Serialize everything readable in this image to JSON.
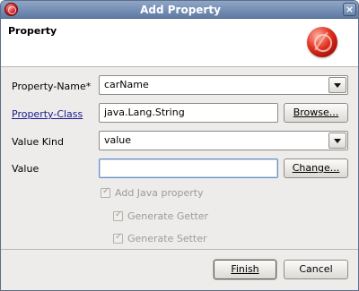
{
  "window": {
    "title": "Add Property"
  },
  "header": {
    "title": "Property"
  },
  "form": {
    "property_name": {
      "label": "Property-Name*",
      "value": "carName"
    },
    "property_class": {
      "label": "Property-Class",
      "value": "java.Lang.String",
      "browse_label": "Browse..."
    },
    "value_kind": {
      "label": "Value Kind",
      "value": "value"
    },
    "value": {
      "label": "Value",
      "value": "",
      "change_label": "Change..."
    },
    "add_java_property": {
      "label": "Add Java property",
      "checked": true,
      "enabled": false
    },
    "generate_getter": {
      "label": "Generate Getter",
      "checked": true,
      "enabled": false
    },
    "generate_setter": {
      "label": "Generate Setter",
      "checked": true,
      "enabled": false
    }
  },
  "buttons": {
    "finish": "Finish",
    "cancel": "Cancel"
  },
  "icons": {
    "app": "app-ball-icon",
    "close": "close-icon",
    "wizard": "wizard-banner-icon",
    "dropdown": "chevron-down-icon"
  }
}
